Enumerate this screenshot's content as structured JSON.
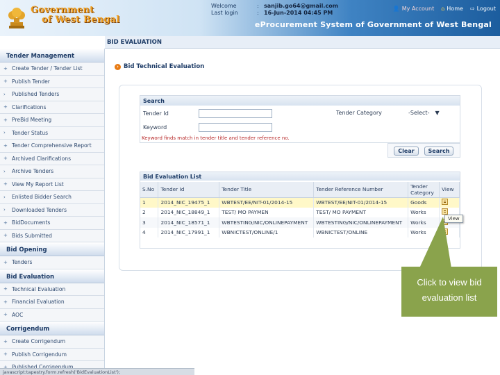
{
  "header": {
    "gov_title_line1": "Government",
    "gov_title_line2": "of West Bengal",
    "welcome_label": "Welcome",
    "welcome_value": "sanjib.go64@gmail.com",
    "last_login_label": "Last login",
    "last_login_value": "16-Jun-2014 04:45 PM",
    "nav": {
      "my_account": "My Account",
      "home": "Home",
      "logout": "Logout"
    },
    "portal_title": "eProcurement System of Government of West Bengal"
  },
  "page": {
    "tab_title": "BID EVALUATION",
    "subtitle": "Bid Technical Evaluation"
  },
  "sidebar": {
    "sections": [
      {
        "title": "Tender Management",
        "items": [
          "Create Tender / Tender List",
          "Publish Tender",
          "Published Tenders",
          "Clarifications",
          "PreBid Meeting",
          "Tender Status",
          "Tender Comprehensive Report",
          "Archived Clarifications",
          "Archive Tenders",
          "View My Report List",
          "Enlisted Bidder Search",
          "Downloaded Tenders",
          "BidDocuments",
          "Bids Submitted"
        ]
      },
      {
        "title": "Bid Opening",
        "items": [
          "Tenders"
        ]
      },
      {
        "title": "Bid Evaluation",
        "items": [
          "Technical Evaluation",
          "Financial Evaluation",
          "AOC"
        ]
      },
      {
        "title": "Corrigendum",
        "items": [
          "Create Corrigendum",
          "Publish Corrigendum",
          "Published Corrigendum"
        ]
      }
    ]
  },
  "search": {
    "title": "Search",
    "tender_id_label": "Tender Id",
    "keyword_label": "Keyword",
    "tender_category_label": "Tender Category",
    "tender_category_value": "-Select-",
    "hint": "Keyword finds match in tender title and tender reference no.",
    "clear_label": "Clear",
    "search_label": "Search"
  },
  "list": {
    "title": "Bid Evaluation List",
    "columns": [
      "S.No",
      "Tender Id",
      "Tender Title",
      "Tender Reference Number",
      "Tender Category",
      "View"
    ],
    "rows": [
      [
        "1",
        "2014_NIC_19475_1",
        "WBTEST/EE/NIT-01/2014-15",
        "WBTEST/EE/NIT-01/2014-15",
        "Goods"
      ],
      [
        "2",
        "2014_NIC_18849_1",
        "TEST/ MO PAYMEN",
        "TEST/ MO PAYMENT",
        "Works"
      ],
      [
        "3",
        "2014_NIC_18571_1",
        "WBTESTING/NIC/ONLINEPAYMENT",
        "WBTESTING/NIC/ONLINEPAYMENT",
        "Works"
      ],
      [
        "4",
        "2014_NIC_17991_1",
        "WBNICTEST/ONLINE/1",
        "WBNICTEST/ONLINE",
        "Works"
      ]
    ],
    "tooltip": "View"
  },
  "callout": {
    "text": "Click to view bid evaluation list",
    "color": "#8aa34c"
  },
  "status_bar": "javascript:tapestry.form.refresh('BidEvaluationList');"
}
